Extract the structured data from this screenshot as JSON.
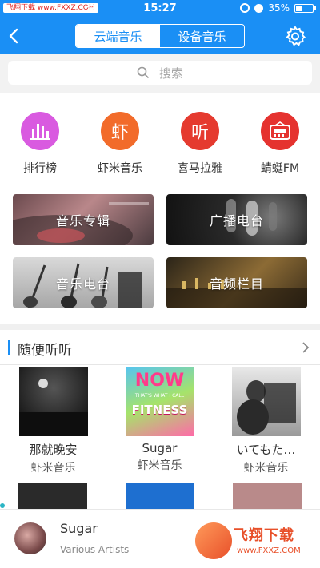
{
  "status_bar": {
    "watermark": "飞翔下载 www.FXXZ.COM",
    "time": "15:27",
    "battery": "35%",
    "battery_level": 0.35
  },
  "nav": {
    "tabs": [
      {
        "label": "云端音乐",
        "active": true
      },
      {
        "label": "设备音乐",
        "active": false
      }
    ],
    "back_icon": "chevron-left-icon",
    "settings_icon": "gear-icon"
  },
  "search": {
    "placeholder": "搜索"
  },
  "categories": [
    {
      "label": "排行榜",
      "color": "#d95ae0",
      "icon": "bars-icon"
    },
    {
      "label": "虾米音乐",
      "color": "#f26b2a",
      "icon": "虾"
    },
    {
      "label": "喜马拉雅",
      "color": "#e53a2f",
      "icon": "听"
    },
    {
      "label": "蜻蜓FM",
      "color": "#e5322f",
      "icon": "radio-icon"
    }
  ],
  "banners": [
    {
      "label": "音乐专辑"
    },
    {
      "label": "广播电台"
    },
    {
      "label": "音乐电台"
    },
    {
      "label": "音频栏目"
    }
  ],
  "section": {
    "title": "随便听听"
  },
  "albums": [
    {
      "name": "那就晚安",
      "source": "虾米音乐"
    },
    {
      "name": "Sugar",
      "source": "虾米音乐",
      "cover_text_1": "NOW",
      "cover_text_2": "THAT'S WHAT I CALL",
      "cover_text_3": "FITNESS"
    },
    {
      "name": "いてもた…",
      "source": "虾米音乐"
    }
  ],
  "player": {
    "title": "Sugar",
    "artist": "Various Artists"
  },
  "brand": {
    "name": "飞翔下载",
    "url": "www.FXXZ.COM"
  },
  "colors": {
    "primary": "#1a8ff5",
    "section_bar": "#1a8ff5"
  }
}
